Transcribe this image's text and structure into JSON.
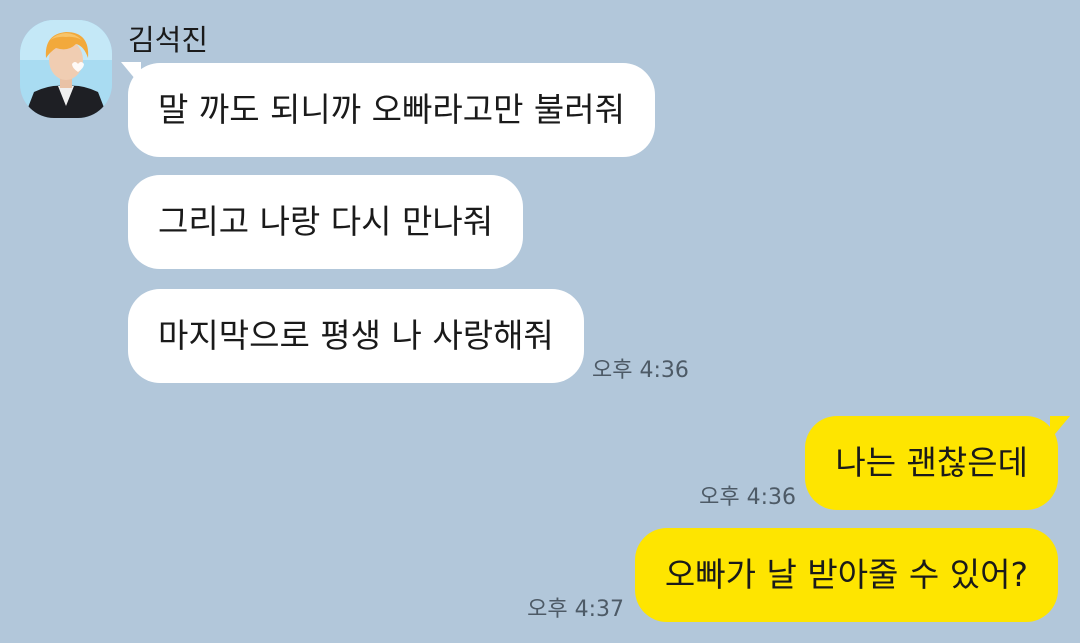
{
  "chat": {
    "sender": {
      "name": "김석진",
      "avatar_icon": "profile-photo"
    },
    "incoming": [
      {
        "text": "말 까도 되니까 오빠라고만 불러줘"
      },
      {
        "text": "그리고 나랑 다시 만나줘"
      },
      {
        "text": "마지막으로 평생 나 사랑해줘",
        "time": "오후 4:36"
      }
    ],
    "outgoing": [
      {
        "text": "나는 괜찮은데",
        "time": "오후 4:36"
      },
      {
        "text": "오빠가 날 받아줄 수 있어?",
        "time": "오후 4:37"
      }
    ]
  },
  "colors": {
    "background": "#b2c7da",
    "incoming_bubble": "#ffffff",
    "outgoing_bubble": "#fee500",
    "text": "#1a1a1a",
    "timestamp": "#4d5a66"
  }
}
